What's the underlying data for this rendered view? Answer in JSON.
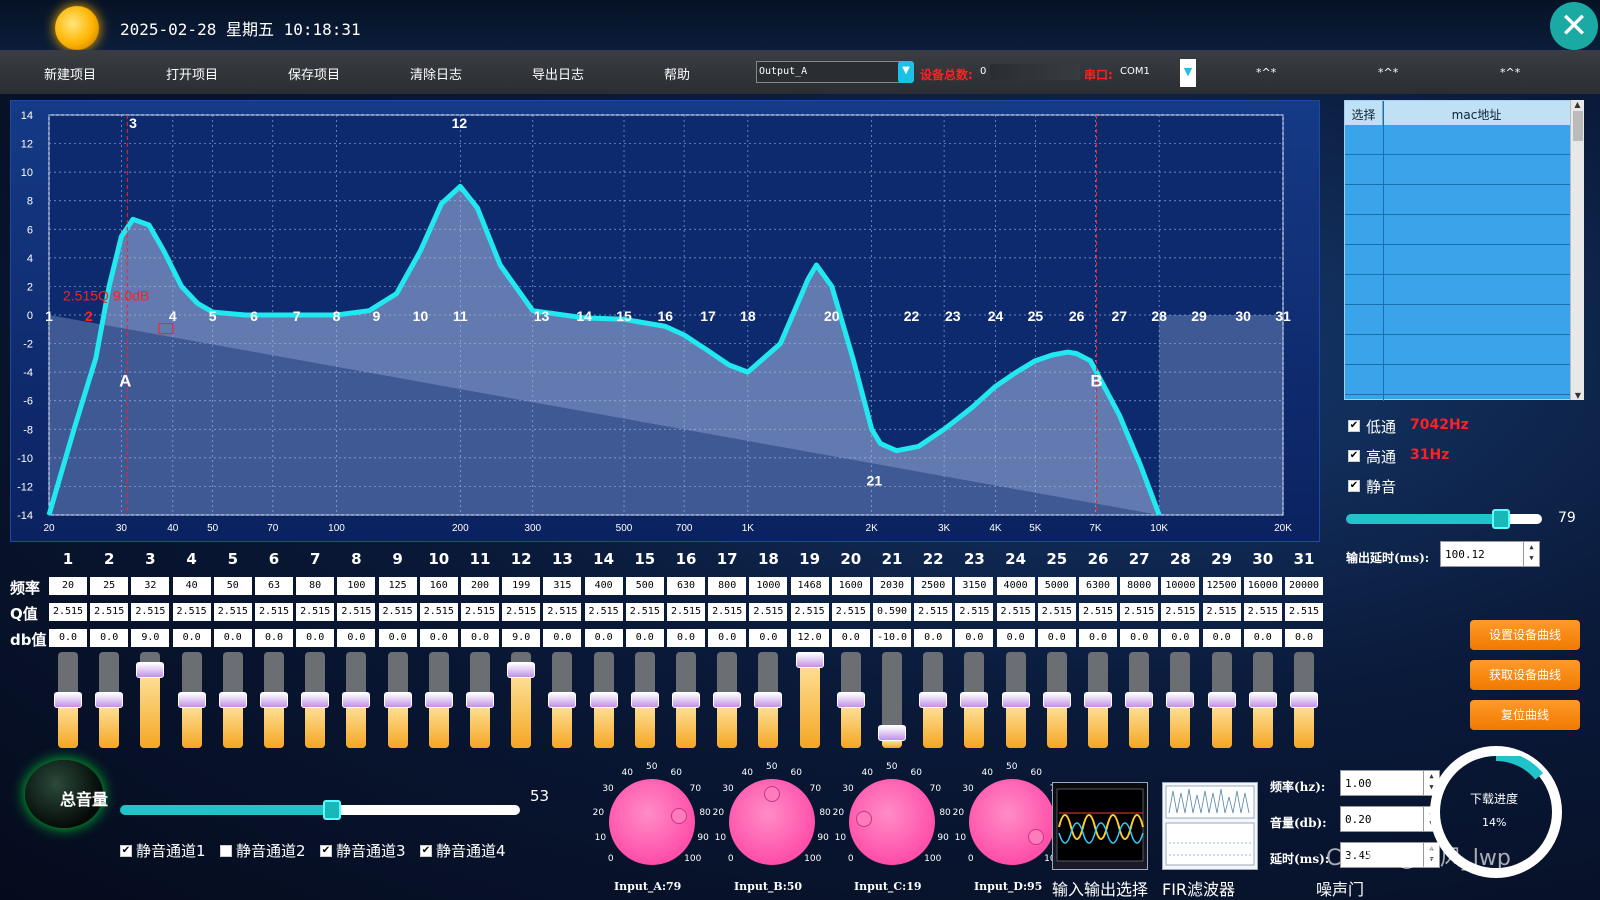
{
  "header": {
    "datetime": "2025-02-28 星期五 10:18:31",
    "close_icon": "close-icon"
  },
  "menu": {
    "items": [
      "新建项目",
      "打开项目",
      "保存项目",
      "清除日志",
      "导出日志",
      "帮助"
    ],
    "output_select": "Output_A",
    "device_count_label": "设备总数:",
    "device_count_value": "0",
    "port_label": "串口:",
    "port_value": "COM1",
    "extra_glyphs": [
      "*^*",
      "*^*",
      "*^*"
    ]
  },
  "chart_data": {
    "type": "line",
    "title": "",
    "xlabel": "",
    "ylabel": "",
    "x_scale": "log",
    "xlim": [
      20,
      20000
    ],
    "ylim": [
      -14,
      14
    ],
    "x_ticks": [
      20,
      30,
      40,
      50,
      70,
      100,
      200,
      300,
      500,
      700,
      1000,
      2000,
      3000,
      4000,
      5000,
      7000,
      10000,
      20000
    ],
    "x_tick_labels": [
      "20",
      "30",
      "40",
      "50",
      "70",
      "100",
      "200",
      "300",
      "500",
      "700",
      "1K",
      "2K",
      "3K",
      "4K",
      "5K",
      "7K",
      "10K",
      "20K"
    ],
    "y_ticks": [
      14,
      12,
      10,
      8,
      6,
      4,
      2,
      0,
      -2,
      -4,
      -6,
      -8,
      -10,
      -12,
      -14
    ],
    "grid": true,
    "series": [
      {
        "x": [
          20,
          23,
          26,
          28,
          30,
          32,
          35,
          38,
          42,
          46,
          50,
          60,
          80,
          100,
          120,
          140,
          160,
          180,
          200,
          220,
          250,
          300,
          400,
          500,
          630,
          700,
          800,
          900,
          1000,
          1200,
          1400,
          1468,
          1600,
          1800,
          2000,
          2100,
          2300,
          2600,
          3000,
          3500,
          4000,
          4500,
          5000,
          5500,
          6000,
          6300,
          6800,
          7042,
          8000,
          9000,
          10000
        ],
        "y": [
          -14,
          -8,
          -3,
          2,
          5.5,
          6.7,
          6.3,
          4.5,
          2,
          0.8,
          0.2,
          0,
          0,
          0,
          0.3,
          1.5,
          4.5,
          7.8,
          9,
          7.5,
          3.5,
          0.3,
          -0.2,
          -0.3,
          -0.8,
          -1.4,
          -2.5,
          -3.5,
          -4,
          -2,
          2.5,
          3.5,
          2,
          -3,
          -8,
          -9,
          -9.5,
          -9.2,
          -8,
          -6.5,
          -5,
          -4,
          -3.2,
          -2.8,
          -2.6,
          -2.7,
          -3.2,
          -4,
          -7,
          -10.5,
          -14
        ]
      }
    ],
    "point_labels": [
      "1",
      "2",
      "3",
      "4",
      "5",
      "6",
      "7",
      "8",
      "9",
      "10",
      "11",
      "12",
      "13",
      "14",
      "15",
      "16",
      "17",
      "18",
      "19",
      "20",
      "21",
      "22",
      "23",
      "24",
      "25",
      "26",
      "27",
      "28",
      "29",
      "30",
      "31"
    ],
    "marker_a": "A",
    "marker_b": "B",
    "info_text": "2.515Q 9.0dB",
    "info_marker": "2"
  },
  "device_table": {
    "headers": [
      "选择",
      "mac地址"
    ],
    "rows": 9
  },
  "filters": {
    "lowpass_label": "低通",
    "lowpass_value": "7042Hz",
    "highpass_label": "高通",
    "highpass_value": "31Hz",
    "mute_label": "静音",
    "output_slider_value": "79",
    "output_slider_percent": 0.79,
    "delay_label": "输出延时(ms):",
    "delay_value": "100.12"
  },
  "eq": {
    "row_labels": [
      "频率",
      "Q值",
      "db值"
    ],
    "channels": [
      "1",
      "2",
      "3",
      "4",
      "5",
      "6",
      "7",
      "8",
      "9",
      "10",
      "11",
      "12",
      "13",
      "14",
      "15",
      "16",
      "17",
      "18",
      "19",
      "20",
      "21",
      "22",
      "23",
      "24",
      "25",
      "26",
      "27",
      "28",
      "29",
      "30",
      "31"
    ],
    "freq": [
      "20",
      "25",
      "32",
      "40",
      "50",
      "63",
      "80",
      "100",
      "125",
      "160",
      "200",
      "199",
      "315",
      "400",
      "500",
      "630",
      "800",
      "1000",
      "1468",
      "1600",
      "2030",
      "2500",
      "3150",
      "4000",
      "5000",
      "6300",
      "8000",
      "10000",
      "12500",
      "16000",
      "20000"
    ],
    "q": [
      "2.515",
      "2.515",
      "2.515",
      "2.515",
      "2.515",
      "2.515",
      "2.515",
      "2.515",
      "2.515",
      "2.515",
      "2.515",
      "2.515",
      "2.515",
      "2.515",
      "2.515",
      "2.515",
      "2.515",
      "2.515",
      "2.515",
      "2.515",
      "0.590",
      "2.515",
      "2.515",
      "2.515",
      "2.515",
      "2.515",
      "2.515",
      "2.515",
      "2.515",
      "2.515",
      "2.515"
    ],
    "db": [
      "0.0",
      "0.0",
      "9.0",
      "0.0",
      "0.0",
      "0.0",
      "0.0",
      "0.0",
      "0.0",
      "0.0",
      "0.0",
      "9.0",
      "0.0",
      "0.0",
      "0.0",
      "0.0",
      "0.0",
      "0.0",
      "12.0",
      "0.0",
      "-10.0",
      "0.0",
      "0.0",
      "0.0",
      "0.0",
      "0.0",
      "0.0",
      "0.0",
      "0.0",
      "0.0",
      "0.0"
    ]
  },
  "buttons": {
    "set_curve": "设置设备曲线",
    "get_curve": "获取设备曲线",
    "reset_curve": "复位曲线"
  },
  "master": {
    "label": "总音量",
    "value": "53",
    "percent": 0.53,
    "mutes": [
      "静音通道1",
      "静音通道2",
      "静音通道3",
      "静音通道4"
    ],
    "mute_checked": [
      true,
      false,
      true,
      true
    ]
  },
  "dials": [
    {
      "label": "Input_A:79",
      "value": 79
    },
    {
      "label": "Input_B:50",
      "value": 50
    },
    {
      "label": "Input_C:19",
      "value": 19
    },
    {
      "label": "Input_D:95",
      "value": 95
    }
  ],
  "dial_ticks": [
    "0",
    "10",
    "20",
    "30",
    "40",
    "50",
    "60",
    "70",
    "80",
    "90",
    "100"
  ],
  "thumbs": {
    "io_select": "输入输出选择",
    "fir": "FIR滤波器",
    "noise_gate": "噪声门"
  },
  "gate": {
    "freq_label": "频率(hz):",
    "freq_value": "1.00",
    "vol_label": "音量(db):",
    "vol_value": "0.20",
    "delay_label": "延时(ms):",
    "delay_value": "3.45"
  },
  "progress": {
    "title": "下载进度",
    "value": "14%",
    "fraction": 0.14
  },
  "watermark": "CSDN @凌风_lwp",
  "colors": {
    "accent": "#1fe0ea",
    "warning": "#ff2020",
    "button": "#f07a00"
  }
}
